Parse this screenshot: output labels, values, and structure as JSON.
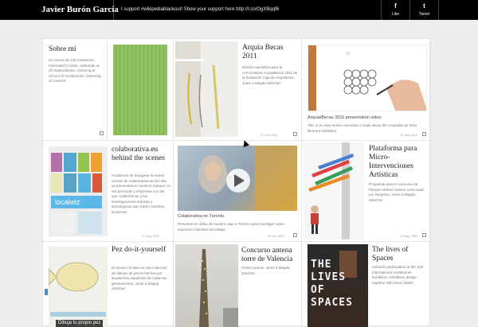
{
  "header": {
    "brand": "Javier Burón García",
    "tweet": "I support #wikipediablackout! Show your support here http://t.co/OgXBqqf6",
    "like_icon": "f",
    "like_label": "Like",
    "tweet_icon": "t",
    "tweet_label": "Tweet"
  },
  "cards": {
    "about": {
      "title": "Sobre mí",
      "desc": "en menos de 140 caracteres... Interested in cities, cofounder at @colaborativaeu, lecturing at School of Architecture, University of Limerick"
    },
    "becas": {
      "title": "Arquia Becas 2011",
      "desc": "Diseño expositivo para la convocatoria ArquiaBecas 2011 de la fundación Caja de Arquitectos. Junto a Magda Sánchez",
      "date": "27 Oct 2011"
    },
    "video": {
      "title": "Arquia/Becas 2011 presentation video",
      "desc": "This is an stop-motion animation I made about the ArquiaBecas 2011 itinerant exhibition.",
      "date": "15 Sep 2011"
    },
    "colaborativa": {
      "title": "colaborativa.eu behind the scenes",
      "desc": "Acabamos de inaugurar la nueva versión de colaborativa.eu! En ella os presentamos nuestros trabajos, la red personas y empresas con las que colaboramos y las investigaciones teóricas y tecnológicas que nutren nuestros proyectos.",
      "date": "17 Aug 2011"
    },
    "toronto": {
      "title": "Colaborativa en Toronto",
      "desc": "Resumen en vídeo de nuestro viaje a Toronto para investigar sobre espacios colectivos de trabajo",
      "date": "15 Oct 2010"
    },
    "plataforma": {
      "title": "Plataforma para Micro-Intervenciones Artísticas",
      "desc": "Propuesta para el concurso de Parque Vertical Urbano convocado por Surgenia. Junto a Magda Sánchez",
      "date": "15 Aug 2009"
    },
    "pez": {
      "title": "Pez do-it-yourself",
      "desc": "El acuario Scalae es una colección de dibujos de peces hechos por arquitectos españoles de todas las generaciones. Junto a Magda Sánchez",
      "overlay": "Dibuja tu propio pez"
    },
    "valencia": {
      "title": "Concurso antena torre de Valencia",
      "desc": "Primer premio. Junto a Magda Sánchez"
    },
    "lives": {
      "title": "The lives of Spaces",
      "desc": "Ireland's participation at the 11th International Architecture Exhibition. Exhibition design together with Kevin Walsh",
      "poster": "THE LIVES OF SPACES"
    }
  }
}
